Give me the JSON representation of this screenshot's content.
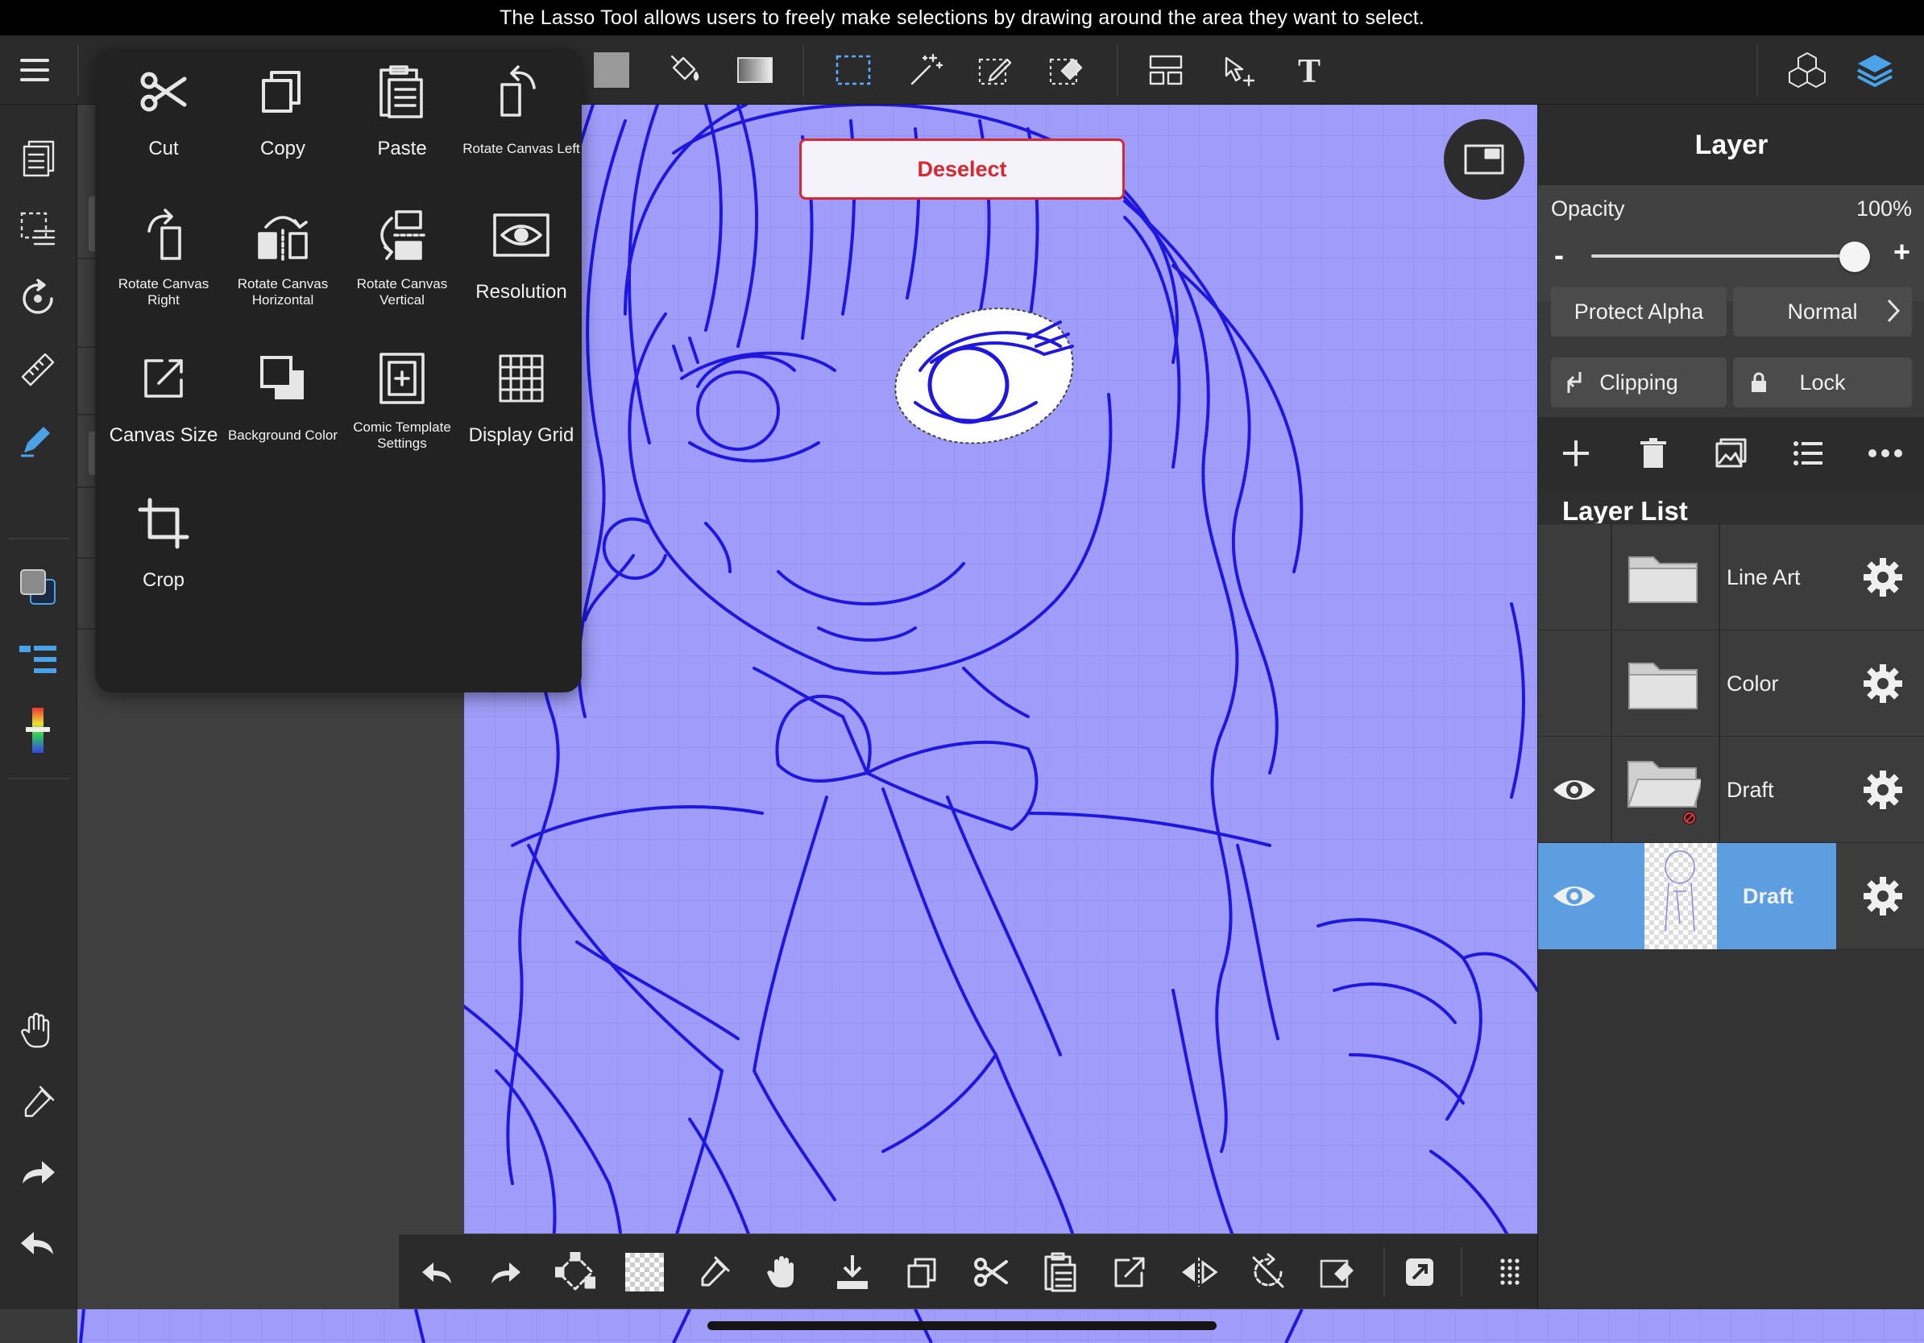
{
  "caption": "The Lasso Tool allows users to freely make selections by drawing around the area they want to select.",
  "topbar": {
    "icons": [
      "menu-icon",
      "color-swatch-icon",
      "fill-bucket-icon",
      "gradient-icon",
      "rect-select-icon",
      "magic-wand-icon",
      "select-pen-icon",
      "select-eraser-icon",
      "frame-divider-icon",
      "move-cursor-icon",
      "text-tool-icon",
      "materials-icon",
      "layers-icon"
    ]
  },
  "menu": {
    "items": [
      {
        "label": "Cut",
        "icon": "scissors-icon"
      },
      {
        "label": "Copy",
        "icon": "copy-icon"
      },
      {
        "label": "Paste",
        "icon": "paste-icon"
      },
      {
        "label": "Rotate Canvas Left",
        "icon": "rotate-left-icon"
      },
      {
        "label": "Rotate Canvas Right",
        "icon": "rotate-right-icon"
      },
      {
        "label": "Rotate Canvas Horizontal",
        "icon": "flip-horizontal-icon"
      },
      {
        "label": "Rotate Canvas Vertical",
        "icon": "flip-vertical-icon"
      },
      {
        "label": "Resolution",
        "icon": "eye-icon"
      },
      {
        "label": "Canvas Size",
        "icon": "canvas-size-icon"
      },
      {
        "label": "Background Color",
        "icon": "background-color-icon"
      },
      {
        "label": "Comic Template Settings",
        "icon": "comic-template-icon"
      },
      {
        "label": "Display Grid",
        "icon": "grid-icon"
      },
      {
        "label": "Crop",
        "icon": "crop-icon"
      }
    ]
  },
  "canvas": {
    "deselect_label": "Deselect",
    "background_color": "#a09dfa",
    "line_color": "#1f17e0"
  },
  "layer_panel": {
    "title": "Layer",
    "opacity_label": "Opacity",
    "opacity_value": "100%",
    "opacity_fraction": 1.0,
    "minus": "-",
    "plus": "+",
    "protect_alpha": "Protect Alpha",
    "blend_mode": "Normal",
    "clipping": "Clipping",
    "lock": "Lock",
    "list_title": "Layer List",
    "layers": [
      {
        "name": "Line Art",
        "type": "folder",
        "visible": false
      },
      {
        "name": "Color",
        "type": "folder",
        "visible": false
      },
      {
        "name": "Draft",
        "type": "folder",
        "visible": true
      },
      {
        "name": "Draft",
        "type": "layer",
        "visible": true,
        "active": true
      }
    ],
    "accent_color": "#5d9ee0"
  }
}
